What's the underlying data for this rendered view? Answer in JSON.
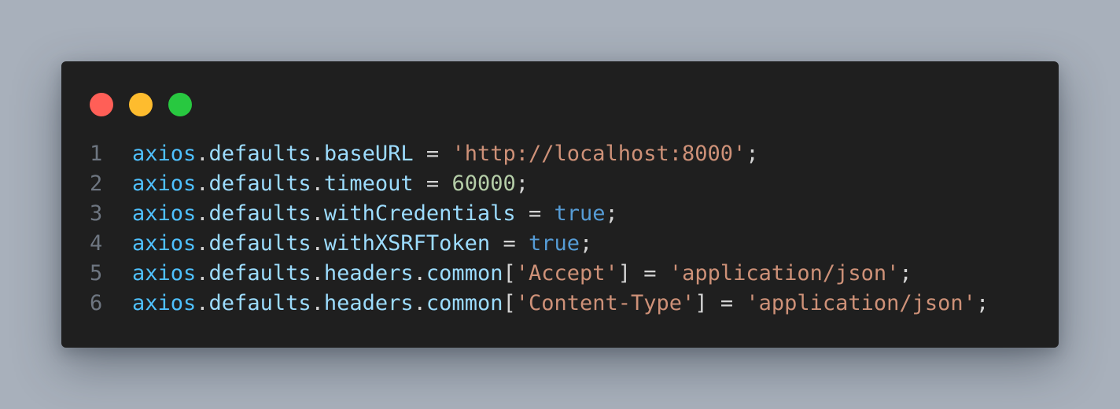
{
  "colors": {
    "background": "#a8b0bb",
    "window": "#1f1f1f",
    "close": "#ff5f57",
    "minimize": "#febc2e",
    "maximize": "#28c840"
  },
  "window_controls": [
    {
      "name": "close-button",
      "color": "#ff5f57"
    },
    {
      "name": "minimize-button",
      "color": "#febc2e"
    },
    {
      "name": "maximize-button",
      "color": "#28c840"
    }
  ],
  "code": {
    "language": "javascript",
    "lines": [
      {
        "number": "1",
        "tokens": [
          {
            "t": "axios",
            "k": "obj"
          },
          {
            "t": ".",
            "k": "op"
          },
          {
            "t": "defaults",
            "k": "prop"
          },
          {
            "t": ".",
            "k": "op"
          },
          {
            "t": "baseURL",
            "k": "prop"
          },
          {
            "t": " = ",
            "k": "op"
          },
          {
            "t": "'http://localhost:8000'",
            "k": "str"
          },
          {
            "t": ";",
            "k": "op"
          }
        ]
      },
      {
        "number": "2",
        "tokens": [
          {
            "t": "axios",
            "k": "obj"
          },
          {
            "t": ".",
            "k": "op"
          },
          {
            "t": "defaults",
            "k": "prop"
          },
          {
            "t": ".",
            "k": "op"
          },
          {
            "t": "timeout",
            "k": "prop"
          },
          {
            "t": " = ",
            "k": "op"
          },
          {
            "t": "60000",
            "k": "num"
          },
          {
            "t": ";",
            "k": "op"
          }
        ]
      },
      {
        "number": "3",
        "tokens": [
          {
            "t": "axios",
            "k": "obj"
          },
          {
            "t": ".",
            "k": "op"
          },
          {
            "t": "defaults",
            "k": "prop"
          },
          {
            "t": ".",
            "k": "op"
          },
          {
            "t": "withCredentials",
            "k": "prop"
          },
          {
            "t": " = ",
            "k": "op"
          },
          {
            "t": "true",
            "k": "kw"
          },
          {
            "t": ";",
            "k": "op"
          }
        ]
      },
      {
        "number": "4",
        "tokens": [
          {
            "t": "axios",
            "k": "obj"
          },
          {
            "t": ".",
            "k": "op"
          },
          {
            "t": "defaults",
            "k": "prop"
          },
          {
            "t": ".",
            "k": "op"
          },
          {
            "t": "withXSRFToken",
            "k": "prop"
          },
          {
            "t": " = ",
            "k": "op"
          },
          {
            "t": "true",
            "k": "kw"
          },
          {
            "t": ";",
            "k": "op"
          }
        ]
      },
      {
        "number": "5",
        "tokens": [
          {
            "t": "axios",
            "k": "obj"
          },
          {
            "t": ".",
            "k": "op"
          },
          {
            "t": "defaults",
            "k": "prop"
          },
          {
            "t": ".",
            "k": "op"
          },
          {
            "t": "headers",
            "k": "prop"
          },
          {
            "t": ".",
            "k": "op"
          },
          {
            "t": "common",
            "k": "prop"
          },
          {
            "t": "[",
            "k": "op"
          },
          {
            "t": "'Accept'",
            "k": "str"
          },
          {
            "t": "] = ",
            "k": "op"
          },
          {
            "t": "'application/json'",
            "k": "str"
          },
          {
            "t": ";",
            "k": "op"
          }
        ]
      },
      {
        "number": "6",
        "tokens": [
          {
            "t": "axios",
            "k": "obj"
          },
          {
            "t": ".",
            "k": "op"
          },
          {
            "t": "defaults",
            "k": "prop"
          },
          {
            "t": ".",
            "k": "op"
          },
          {
            "t": "headers",
            "k": "prop"
          },
          {
            "t": ".",
            "k": "op"
          },
          {
            "t": "common",
            "k": "prop"
          },
          {
            "t": "[",
            "k": "op"
          },
          {
            "t": "'Content-Type'",
            "k": "str"
          },
          {
            "t": "] = ",
            "k": "op"
          },
          {
            "t": "'application/json'",
            "k": "str"
          },
          {
            "t": ";",
            "k": "op"
          }
        ]
      }
    ]
  }
}
